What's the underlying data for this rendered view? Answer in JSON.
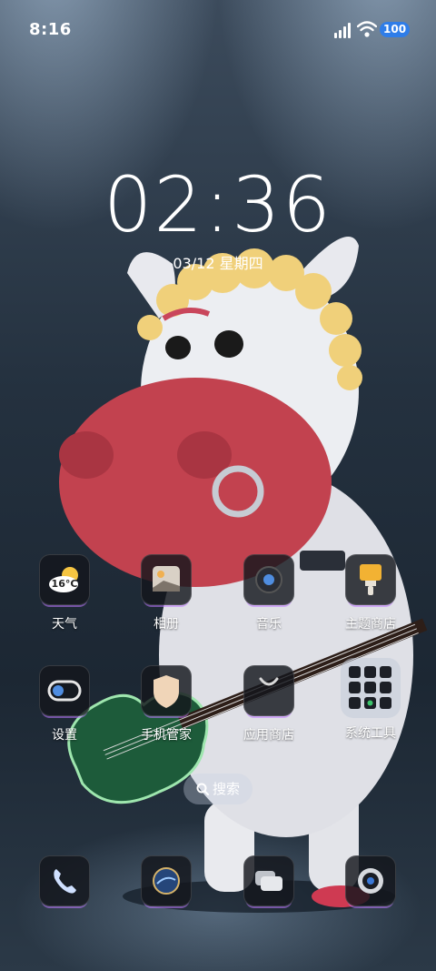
{
  "status_bar": {
    "time": "8:16",
    "battery": "100"
  },
  "lock": {
    "time": "02:36",
    "date": "03/12 星期四"
  },
  "weather_temp": "16°C",
  "apps_row1": [
    {
      "label": "天气",
      "icon": "weather-icon"
    },
    {
      "label": "相册",
      "icon": "gallery-icon"
    },
    {
      "label": "音乐",
      "icon": "music-icon"
    },
    {
      "label": "主题商店",
      "icon": "theme-store-icon"
    }
  ],
  "apps_row2": [
    {
      "label": "设置",
      "icon": "settings-toggle-icon"
    },
    {
      "label": "手机管家",
      "icon": "phone-manager-shield-icon"
    },
    {
      "label": "应用商店",
      "icon": "app-store-bag-icon"
    },
    {
      "label": "系统工具",
      "icon": "system-tools-folder-icon"
    }
  ],
  "search": {
    "label": "搜索"
  },
  "dock": [
    {
      "icon": "phone-icon"
    },
    {
      "icon": "browser-globe-icon"
    },
    {
      "icon": "messages-icon"
    },
    {
      "icon": "camera-icon"
    }
  ]
}
